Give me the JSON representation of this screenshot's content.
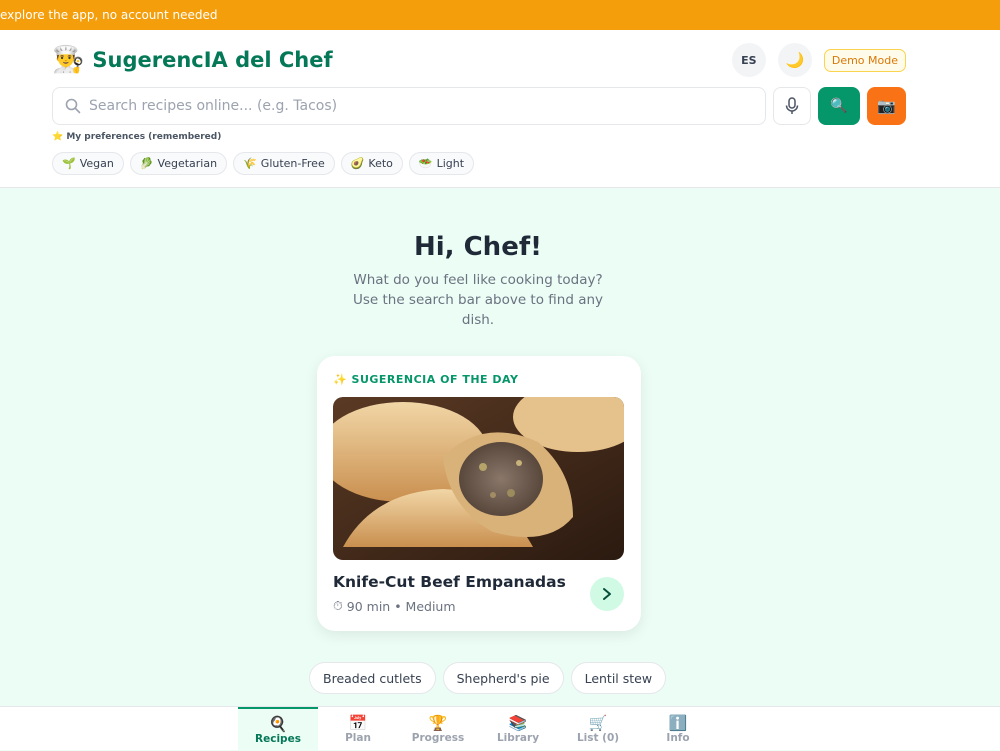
{
  "banner": {
    "text": "explore the app, no account needed"
  },
  "header": {
    "app_icon": "👨‍🍳",
    "title": "SugerencIA del Chef",
    "lang_button": "ES",
    "theme_icon": "🌙",
    "demo_badge": "Demo Mode"
  },
  "search": {
    "placeholder": "Search recipes online... (e.g. Tacos)",
    "value": "",
    "search_button_icon": "🔍",
    "camera_button_icon": "📷"
  },
  "preferences": {
    "label": "⭐ My preferences (remembered)",
    "chips": [
      {
        "icon": "🌱",
        "label": "Vegan"
      },
      {
        "icon": "🥬",
        "label": "Vegetarian"
      },
      {
        "icon": "🌾",
        "label": "Gluten-Free"
      },
      {
        "icon": "🥑",
        "label": "Keto"
      },
      {
        "icon": "🥗",
        "label": "Light"
      }
    ]
  },
  "hero": {
    "title": "Hi, Chef!",
    "subtitle": "What do you feel like cooking today? Use the search bar above to find any dish."
  },
  "suggestion": {
    "kicker": "✨ SUGERENCIA OF THE DAY",
    "dish_name": "Knife-Cut Beef Empanadas",
    "time_icon": "⏱",
    "meta": "90 min • Medium"
  },
  "quick_searches": [
    "Breaded cutlets",
    "Shepherd's pie",
    "Lentil stew"
  ],
  "nav": {
    "items": [
      {
        "icon": "🍳",
        "label": "Recipes",
        "active": true
      },
      {
        "icon": "📅",
        "label": "Plan"
      },
      {
        "icon": "🏆",
        "label": "Progress"
      },
      {
        "icon": "📚",
        "label": "Library"
      },
      {
        "icon": "🛒",
        "label": "List (0)"
      },
      {
        "icon": "ℹ️",
        "label": "Info"
      }
    ]
  },
  "colors": {
    "banner": "#f59e0b",
    "brand_green": "#047857",
    "accent_green": "#059669",
    "accent_orange": "#f97316",
    "page_bg": "#ecfdf5"
  }
}
